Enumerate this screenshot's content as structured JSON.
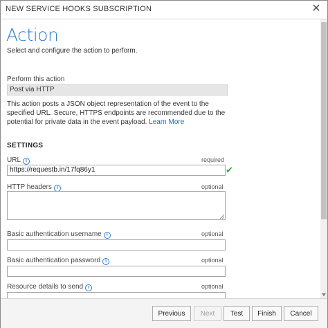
{
  "dialog": {
    "title": "NEW SERVICE HOOKS SUBSCRIPTION",
    "close_glyph": "✕",
    "heading": "Action",
    "subheading": "Select and configure the action to perform."
  },
  "perform": {
    "label": "Perform this action",
    "value": "Post via HTTP",
    "description": "This action posts a JSON object representation of the event to the specified URL. Secure, HTTPS endpoints are recommended due to the potential for private data in the event payload.",
    "learn_more": "Learn More"
  },
  "settings": {
    "title": "SETTINGS",
    "url": {
      "label": "URL",
      "tag": "required",
      "value": "https://requestb.in/17fq86y1",
      "valid_icon": "check-icon"
    },
    "headers": {
      "label": "HTTP headers",
      "tag": "optional",
      "value": ""
    },
    "username": {
      "label": "Basic authentication username",
      "tag": "optional",
      "value": ""
    },
    "password": {
      "label": "Basic authentication password",
      "tag": "optional",
      "value": ""
    },
    "resource": {
      "label": "Resource details to send",
      "tag": "optional"
    }
  },
  "info_glyph": "i",
  "footer": {
    "previous": "Previous",
    "next": "Next",
    "test": "Test",
    "finish": "Finish",
    "cancel": "Cancel"
  },
  "colors": {
    "accent": "#2b7cd3",
    "valid": "#3aa53a"
  }
}
